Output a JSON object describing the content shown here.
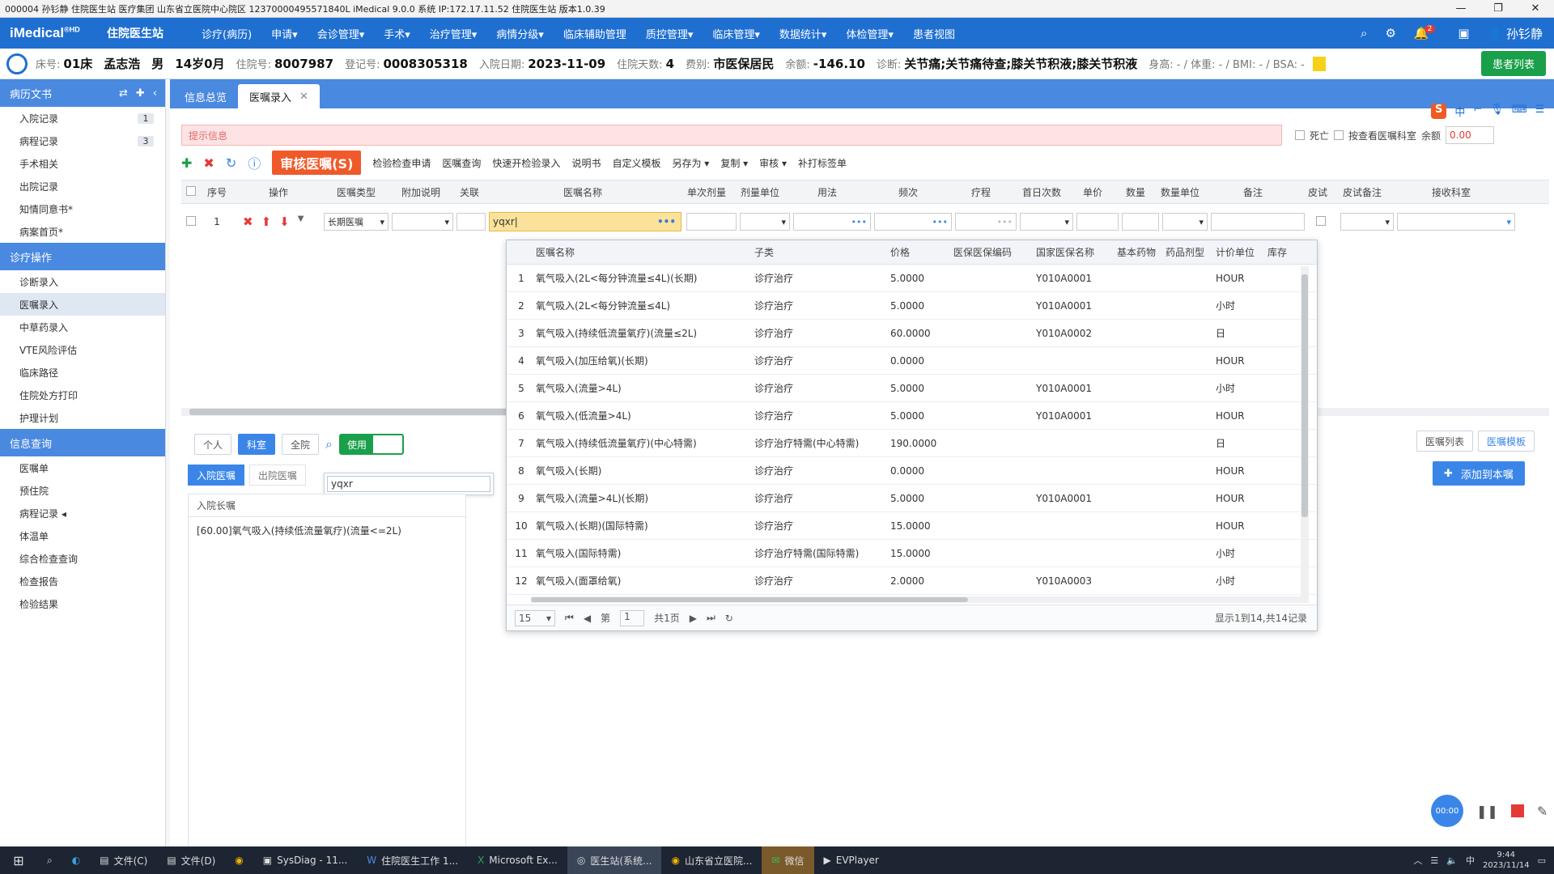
{
  "titlebar": {
    "text": "000004 孙钐静 住院医生站 医疗集团 山东省立医院中心院区 12370000495571840L iMedical 9.0.0 系统 IP:172.17.11.52 住院医生站 版本1.0.39"
  },
  "menubar": {
    "logo": "iMedical",
    "logo_sup": "®HD",
    "station": "住院医生站",
    "items": [
      "诊疗(病历)",
      "申请▾",
      "会诊管理▾",
      "手术▾",
      "治疗管理▾",
      "病情分级▾",
      "临床辅助管理",
      "质控管理▾",
      "临床管理▾",
      "数据统计▾",
      "体检管理▾",
      "患者视图"
    ],
    "notify_count": "2",
    "user": "孙钐静"
  },
  "patient": {
    "bed_label": "床号:",
    "bed": "01床",
    "name": "孟志浩",
    "sex": "男",
    "age": "14岁0月",
    "inpatient_label": "住院号:",
    "inpatient_no": "8007987",
    "reg_label": "登记号:",
    "reg_no": "0008305318",
    "admit_label": "入院日期:",
    "admit_date": "2023-11-09",
    "days_label": "住院天数:",
    "days": "4",
    "fee_label": "费别:",
    "fee_type": "市医保居民",
    "balance_label": "余额:",
    "balance": "-146.10",
    "diag_label": "诊断:",
    "diagnosis": "关节痛;关节痛待查;膝关节积液;膝关节积液",
    "extra": "身高: - / 体重: - / BMI: - / BSA: -",
    "btn": "患者列表"
  },
  "sidebar": {
    "sections": [
      {
        "title": "病历文书",
        "items": [
          {
            "label": "入院记录",
            "count": "1"
          },
          {
            "label": "病程记录",
            "count": "3"
          },
          {
            "label": "手术相关",
            "count": ""
          },
          {
            "label": "出院记录",
            "count": ""
          },
          {
            "label": "知情同意书*",
            "count": ""
          },
          {
            "label": "病案首页*",
            "count": ""
          }
        ]
      },
      {
        "title": "诊疗操作",
        "items": [
          {
            "label": "诊断录入",
            "count": ""
          },
          {
            "label": "医嘱录入",
            "count": ""
          },
          {
            "label": "中草药录入",
            "count": ""
          },
          {
            "label": "VTE风险评估",
            "count": ""
          },
          {
            "label": "临床路径",
            "count": ""
          },
          {
            "label": "住院处方打印",
            "count": ""
          },
          {
            "label": "护理计划",
            "count": ""
          }
        ]
      },
      {
        "title": "信息查询",
        "items": [
          {
            "label": "医嘱单",
            "count": ""
          },
          {
            "label": "预住院",
            "count": ""
          },
          {
            "label": "病程记录 ◂",
            "count": ""
          },
          {
            "label": "体温单",
            "count": ""
          },
          {
            "label": "综合检查查询",
            "count": ""
          },
          {
            "label": "检查报告",
            "count": ""
          },
          {
            "label": "检验结果",
            "count": ""
          }
        ]
      }
    ]
  },
  "tabs": [
    {
      "label": "信息总览"
    },
    {
      "label": "医嘱录入"
    }
  ],
  "alert": {
    "text": "提示信息",
    "right_chk1": "死亡",
    "right_chk2": "按查看医嘱科室",
    "amount_label": "余额",
    "amount": "0.00"
  },
  "toolbar": {
    "review_label": "审核医嘱(S)",
    "buttons": [
      "检验检查申请",
      "医嘱查询",
      "快速开检验录入",
      "说明书",
      "自定义模板",
      "另存为 ▾",
      "复制 ▾",
      "审核 ▾",
      "补打标签单"
    ]
  },
  "grid": {
    "headers": [
      "序号",
      "操作",
      "医嘱类型",
      "附加说明",
      "关联",
      "医嘱名称",
      "单次剂量",
      "剂量单位",
      "用法",
      "频次",
      "疗程",
      "首日次数",
      "单价",
      "数量",
      "数量单位",
      "备注",
      "皮试",
      "皮试备注",
      "接收科室"
    ],
    "row_no": "1",
    "order_type": "长期医嘱",
    "search_value": "yqxr"
  },
  "dropdown": {
    "headers": [
      "医嘱名称",
      "子类",
      "价格",
      "医保医保编码",
      "国家医保名称",
      "基本药物",
      "药品剂型",
      "计价单位",
      "库存"
    ],
    "rows": [
      {
        "no": "1",
        "name": "氧气吸入(2L<每分钟流量≤4L)(长期)",
        "sub": "诊疗治疗",
        "price": "5.0000",
        "code": "",
        "ncode": "Y010A0001",
        "unit": "HOUR"
      },
      {
        "no": "2",
        "name": "氧气吸入(2L<每分钟流量≤4L)",
        "sub": "诊疗治疗",
        "price": "5.0000",
        "code": "",
        "ncode": "Y010A0001",
        "unit": "小时"
      },
      {
        "no": "3",
        "name": "氧气吸入(持续低流量氧疗)(流量≤2L)",
        "sub": "诊疗治疗",
        "price": "60.0000",
        "code": "",
        "ncode": "Y010A0002",
        "unit": "日"
      },
      {
        "no": "4",
        "name": "氧气吸入(加压给氧)(长期)",
        "sub": "诊疗治疗",
        "price": "0.0000",
        "code": "",
        "ncode": "",
        "unit": "HOUR"
      },
      {
        "no": "5",
        "name": "氧气吸入(流量>4L)",
        "sub": "诊疗治疗",
        "price": "5.0000",
        "code": "",
        "ncode": "Y010A0001",
        "unit": "小时"
      },
      {
        "no": "6",
        "name": "氧气吸入(低流量>4L)",
        "sub": "诊疗治疗",
        "price": "5.0000",
        "code": "",
        "ncode": "Y010A0001",
        "unit": "HOUR"
      },
      {
        "no": "7",
        "name": "氧气吸入(持续低流量氧疗)(中心特需)",
        "sub": "诊疗治疗特需(中心特需)",
        "price": "190.0000",
        "code": "",
        "ncode": "",
        "unit": "日"
      },
      {
        "no": "8",
        "name": "氧气吸入(长期)",
        "sub": "诊疗治疗",
        "price": "0.0000",
        "code": "",
        "ncode": "",
        "unit": "HOUR"
      },
      {
        "no": "9",
        "name": "氧气吸入(流量>4L)(长期)",
        "sub": "诊疗治疗",
        "price": "5.0000",
        "code": "",
        "ncode": "Y010A0001",
        "unit": "HOUR"
      },
      {
        "no": "10",
        "name": "氧气吸入(长期)(国际特需)",
        "sub": "诊疗治疗",
        "price": "15.0000",
        "code": "",
        "ncode": "",
        "unit": "HOUR"
      },
      {
        "no": "11",
        "name": "氧气吸入(国际特需)",
        "sub": "诊疗治疗特需(国际特需)",
        "price": "15.0000",
        "code": "",
        "ncode": "",
        "unit": "小时"
      },
      {
        "no": "12",
        "name": "氧气吸入(面罩给氧)",
        "sub": "诊疗治疗",
        "price": "2.0000",
        "code": "",
        "ncode": "Y010A0003",
        "unit": "小时"
      }
    ],
    "pager": {
      "size": "15",
      "page_label": "第",
      "page": "1",
      "total_pages": "共1页",
      "info": "显示1到14,共14记录"
    }
  },
  "filter": {
    "btns": [
      "个人",
      "科室",
      "全院"
    ],
    "toggle": "使用"
  },
  "left_tabs": [
    "入院医嘱",
    "出院医嘱"
  ],
  "left_panel": {
    "head": "入院长嘱",
    "row": "[60.00]氧气吸入(持续低流量氧疗)(流量<=2L)"
  },
  "mini_input": "yqxr",
  "right_btns": [
    "医嘱列表",
    "医嘱模板"
  ],
  "add_btn": "添加到本嘱",
  "recorder": {
    "time": "00:00"
  },
  "taskbar": {
    "apps": [
      "文件(C)",
      "文件(D)",
      "",
      "SysDiag - 11...",
      "住院医生工作 1...",
      "Microsoft Ex...",
      "医生站(系统...",
      "山东省立医院...",
      "微信",
      "EVPlayer"
    ],
    "time": "9:44",
    "date": "2023/11/14"
  }
}
